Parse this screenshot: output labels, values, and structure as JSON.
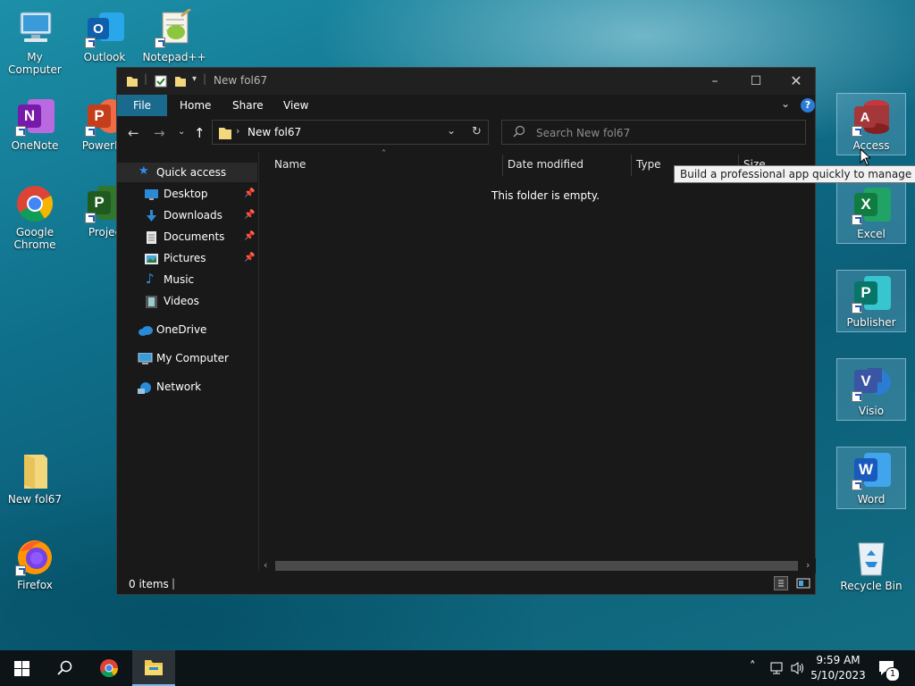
{
  "desktop": {
    "icons_left": [
      {
        "label": "My Computer"
      },
      {
        "label": "Outlook"
      },
      {
        "label": "Notepad++"
      },
      {
        "label": "OneNote"
      },
      {
        "label": "PowerPo"
      },
      {
        "label": "Google Chrome"
      },
      {
        "label": "Projec"
      },
      {
        "label": "New fol67"
      },
      {
        "label": "Firefox"
      }
    ],
    "icons_right": [
      {
        "label": "Access"
      },
      {
        "label": "Excel"
      },
      {
        "label": "Publisher"
      },
      {
        "label": "Visio"
      },
      {
        "label": "Word"
      },
      {
        "label": "Recycle Bin"
      }
    ]
  },
  "explorer": {
    "title": "New fol67",
    "ribbon_tabs": [
      "File",
      "Home",
      "Share",
      "View"
    ],
    "address": {
      "crumb": "New fol67"
    },
    "search": {
      "placeholder": "Search New fol67"
    },
    "nav": {
      "quick_access": "Quick access",
      "quick_items": [
        "Desktop",
        "Downloads",
        "Documents",
        "Pictures",
        "Music",
        "Videos"
      ],
      "onedrive": "OneDrive",
      "my_computer": "My Computer",
      "network": "Network"
    },
    "columns": [
      "Name",
      "Date modified",
      "Type",
      "Size"
    ],
    "empty_message": "This folder is empty.",
    "status": "0 items"
  },
  "tooltip": "Build a professional app quickly to manage data.",
  "taskbar": {
    "time": "9:59 AM",
    "date": "5/10/2023",
    "notification_count": "1"
  },
  "colors": {
    "accent": "#1a6a8e",
    "window_bg": "#191919",
    "access": "#a4373a",
    "excel": "#107c41",
    "publisher": "#077568",
    "visio": "#3955a3",
    "word": "#185abd"
  }
}
